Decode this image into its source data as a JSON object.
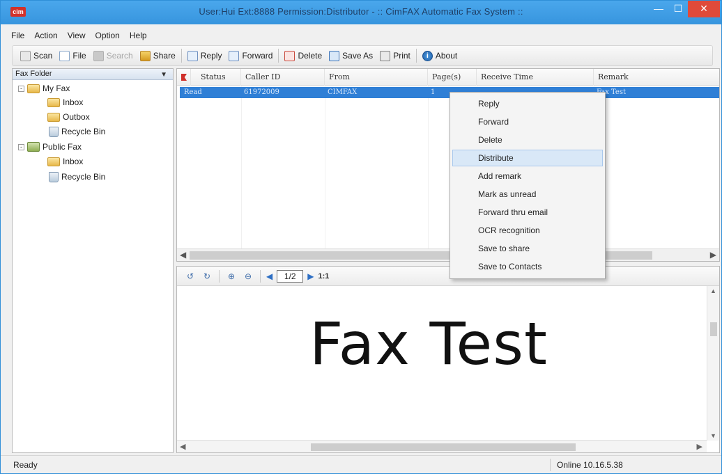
{
  "window": {
    "title": "User:Hui  Ext:8888  Permission:Distributor - :: CimFAX Automatic Fax System ::",
    "app_icon_text": "cim"
  },
  "menubar": [
    "File",
    "Action",
    "View",
    "Option",
    "Help"
  ],
  "toolbar": {
    "scan": "Scan",
    "file": "File",
    "search": "Search",
    "share": "Share",
    "reply": "Reply",
    "forward": "Forward",
    "delete": "Delete",
    "save_as": "Save As",
    "print": "Print",
    "about": "About"
  },
  "folders": {
    "header": "Fax Folder",
    "my_fax": "My Fax",
    "inbox": "Inbox",
    "outbox": "Outbox",
    "recycle_bin": "Recycle Bin",
    "public_fax": "Public Fax",
    "public_inbox": "Inbox",
    "public_recycle_bin": "Recycle Bin"
  },
  "list": {
    "columns": [
      "Status",
      "Caller ID",
      "From",
      "Page(s)",
      "Receive Time",
      "Remark"
    ],
    "selected_row": {
      "status": "Read",
      "caller_id": "61972009",
      "from": "CIMFAX",
      "pages": "1",
      "receive_time": "",
      "remark": "Fax Test"
    }
  },
  "preview": {
    "page_indicator": "1/2",
    "zoom_label": "1:1",
    "content_text": "Fax Test"
  },
  "context_menu": {
    "items": [
      "Reply",
      "Forward",
      "Delete",
      "Distribute",
      "Add remark",
      "Mark as unread",
      "Forward thru email",
      "OCR recognition",
      "Save to share",
      "Save to Contacts"
    ],
    "highlighted": "Distribute"
  },
  "status": {
    "left": "Ready",
    "right": "Online 10.16.5.38"
  },
  "colors": {
    "titlebar": "#3795de",
    "selection": "#2f7fd6",
    "close_button": "#e04a3a",
    "menu_hover": "#d9e8f7"
  }
}
